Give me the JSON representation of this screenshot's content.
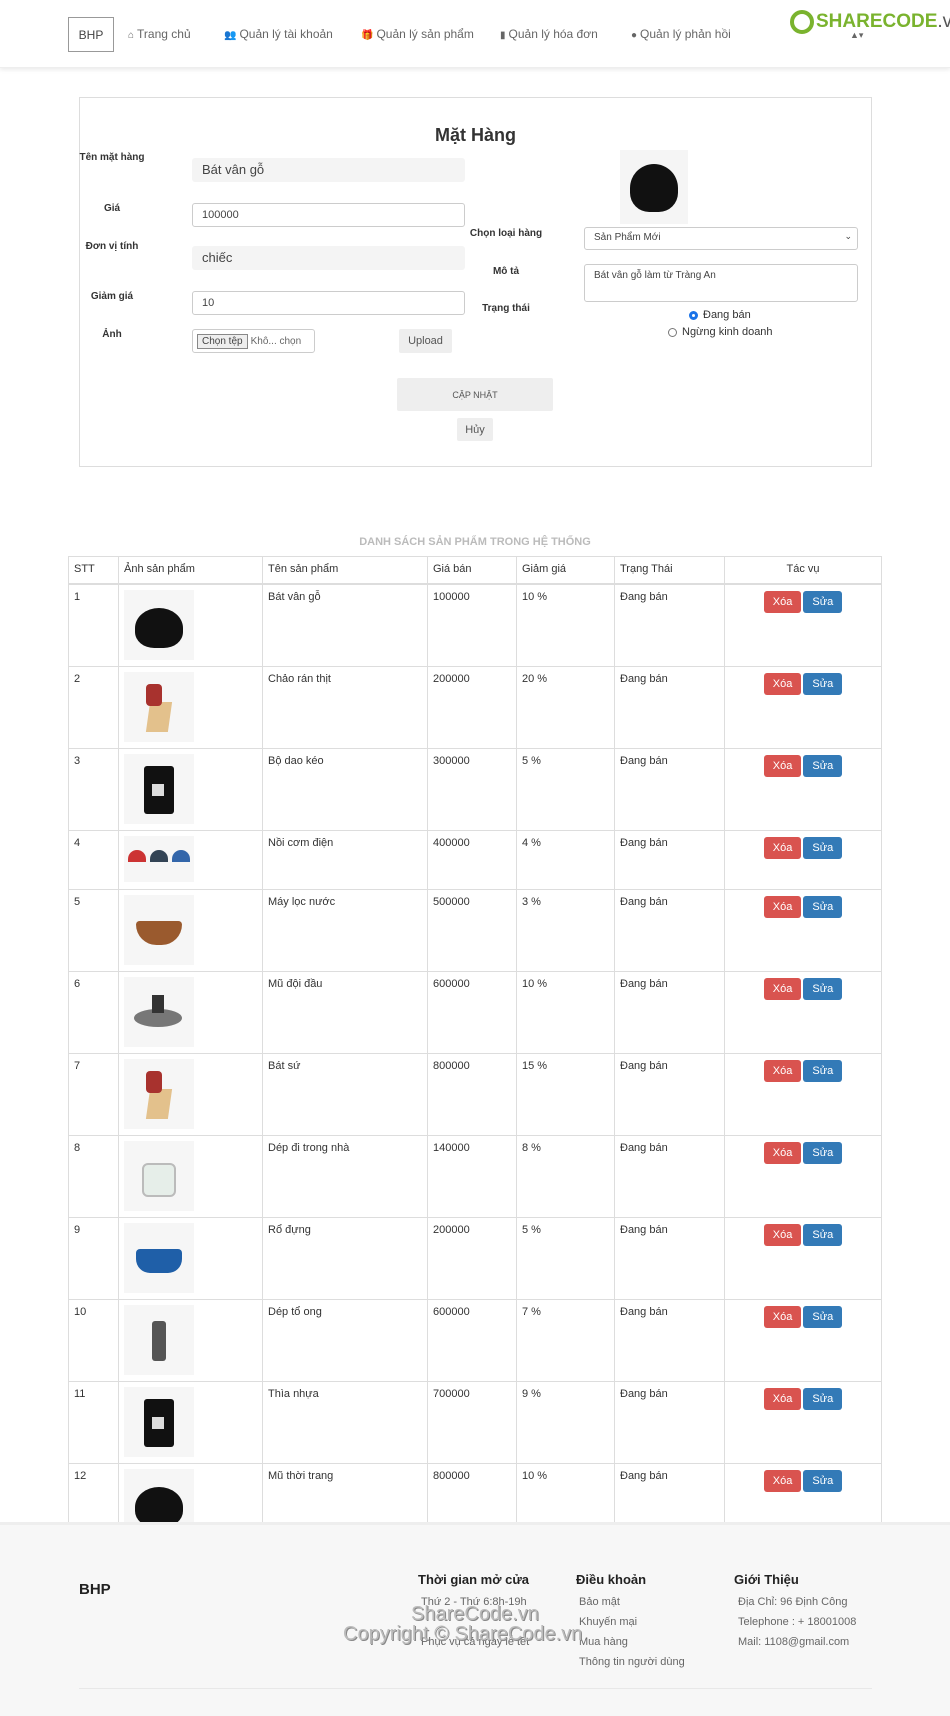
{
  "nav": {
    "brand": "BHP",
    "items": [
      {
        "label": "Trang chủ",
        "icon": "home-icon"
      },
      {
        "label": "Quản lý tài khoản",
        "icon": "users-icon"
      },
      {
        "label": "Quản lý sản phẩm",
        "icon": "gift-icon"
      },
      {
        "label": "Quản lý hóa đơn",
        "icon": "file-icon"
      },
      {
        "label": "Quản lý phản hồi",
        "icon": "comment-icon"
      }
    ],
    "logo": {
      "brand": "SHARECODE",
      "suffix": ".vn"
    }
  },
  "form": {
    "title": "Mặt Hàng",
    "name_label": "Tên mặt hàng",
    "name_value": "Bát vân gỗ",
    "price_label": "Giá",
    "price_value": "100000",
    "unit_label": "Đơn vị tính",
    "unit_value": "chiếc",
    "discount_label": "Giảm giá",
    "discount_value": "10",
    "image_label": "Ảnh",
    "file_button": "Chọn tệp",
    "file_status": "Khô... chọn",
    "upload": "Upload",
    "category_label": "Chọn loại hàng",
    "category_value": "Sản Phẩm Mới",
    "desc_label": "Mô tả",
    "desc_value": "Bát vân gỗ làm từ Tràng An",
    "status_label": "Trạng thái",
    "status_options": [
      "Đang bán",
      "Ngừng kinh doanh"
    ],
    "status_selected": "Đang bán",
    "update": "CẬP NHẬT",
    "cancel": "Hủy"
  },
  "table": {
    "title": "DANH SÁCH SẢN PHẨM TRONG HỆ THỐNG",
    "headers": [
      "STT",
      "Ảnh sản phẩm",
      "Tên sản phẩm",
      "Giá bán",
      "Giảm giá",
      "Trạng Thái",
      "Tác vụ"
    ],
    "delete": "Xóa",
    "edit": "Sửa",
    "rows": [
      {
        "stt": "1",
        "img": "bucket-hat",
        "name": "Bát vân gỗ",
        "price": "100000",
        "discount": "10 %",
        "status": "Đang bán"
      },
      {
        "stt": "2",
        "img": "knife-block",
        "name": "Chảo rán thịt",
        "price": "200000",
        "discount": "20 %",
        "status": "Đang bán"
      },
      {
        "stt": "3",
        "img": "coffee-machine",
        "name": "Bộ dao kéo",
        "price": "300000",
        "discount": "5 %",
        "status": "Đang bán"
      },
      {
        "stt": "4",
        "img": "caps",
        "name": "Nồi cơm điện",
        "price": "400000",
        "discount": "4 %",
        "status": "Đang bán"
      },
      {
        "stt": "5",
        "img": "wooden-bowl",
        "name": "Máy lọc nước",
        "price": "500000",
        "discount": "3 %",
        "status": "Đang bán"
      },
      {
        "stt": "6",
        "img": "burger-press",
        "name": "Mũ đội đầu",
        "price": "600000",
        "discount": "10 %",
        "status": "Đang bán"
      },
      {
        "stt": "7",
        "img": "knife-block",
        "name": "Bát sứ",
        "price": "800000",
        "discount": "15 %",
        "status": "Đang bán"
      },
      {
        "stt": "8",
        "img": "kettle",
        "name": "Dép đi trong nhà",
        "price": "140000",
        "discount": "8 %",
        "status": "Đang bán"
      },
      {
        "stt": "9",
        "img": "blue-pot",
        "name": "Rổ đựng",
        "price": "200000",
        "discount": "5 %",
        "status": "Đang bán"
      },
      {
        "stt": "10",
        "img": "grinder",
        "name": "Dép tổ ong",
        "price": "600000",
        "discount": "7 %",
        "status": "Đang bán"
      },
      {
        "stt": "11",
        "img": "coffee-machine",
        "name": "Thìa nhựa",
        "price": "700000",
        "discount": "9 %",
        "status": "Đang bán"
      },
      {
        "stt": "12",
        "img": "bucket-hat",
        "name": "Mũ thời trang",
        "price": "800000",
        "discount": "10 %",
        "status": "Đang bán"
      }
    ]
  },
  "footer": {
    "brand": "BHP",
    "cols": [
      {
        "title": "Thời gian mở cửa",
        "items": [
          "Thứ 2 - Thứ 6:8h-19h",
          "Phục vụ cả ngày lễ tết"
        ]
      },
      {
        "title": "Điều khoản",
        "items": [
          "Bảo mật",
          "Khuyến mại",
          "Mua hàng",
          "Thông tin người dùng"
        ]
      },
      {
        "title": "Giới Thiệu",
        "items": [
          "Địa Chỉ: 96 Định Công",
          "Telephone : + 18001008",
          "Mail: 1108@gmail.com"
        ]
      }
    ],
    "watermark1": "ShareCode.vn",
    "watermark2": "Copyright © ShareCode.vn"
  },
  "colors": {
    "delete": "#d9534f",
    "edit": "#337ab7",
    "logo": "#7ab32e"
  }
}
